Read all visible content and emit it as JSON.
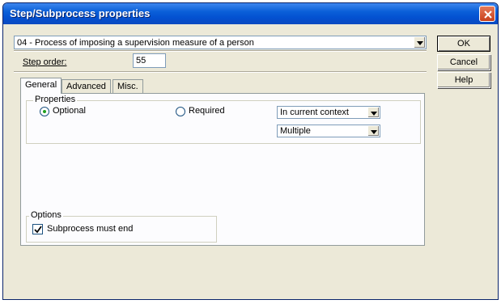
{
  "window": {
    "title": "Step/Subprocess properties"
  },
  "step": {
    "selected": "04 - Process of imposing a supervision measure of a person"
  },
  "step_order": {
    "label": "Step order:",
    "value": "55"
  },
  "buttons": {
    "ok": "OK",
    "cancel": "Cancel",
    "help": "Help"
  },
  "tabs": [
    {
      "label": "General"
    },
    {
      "label": "Advanced"
    },
    {
      "label": "Misc."
    }
  ],
  "properties": {
    "group_label": "Properties",
    "optional_label": "Optional",
    "optional_selected": true,
    "required_label": "Required",
    "required_selected": false,
    "context_selected": "In current context",
    "multiplicity_selected": "Multiple"
  },
  "options": {
    "group_label": "Options",
    "subprocess_must_end_label": "Subprocess must end",
    "subprocess_must_end_checked": true
  },
  "icons": {
    "close": "close-icon",
    "dropdown": "chevron-down-icon",
    "check": "check-icon"
  },
  "colors": {
    "titlebar": "#0a5fd8",
    "window_bg": "#ece9d8",
    "radio_dot": "#21a121"
  }
}
